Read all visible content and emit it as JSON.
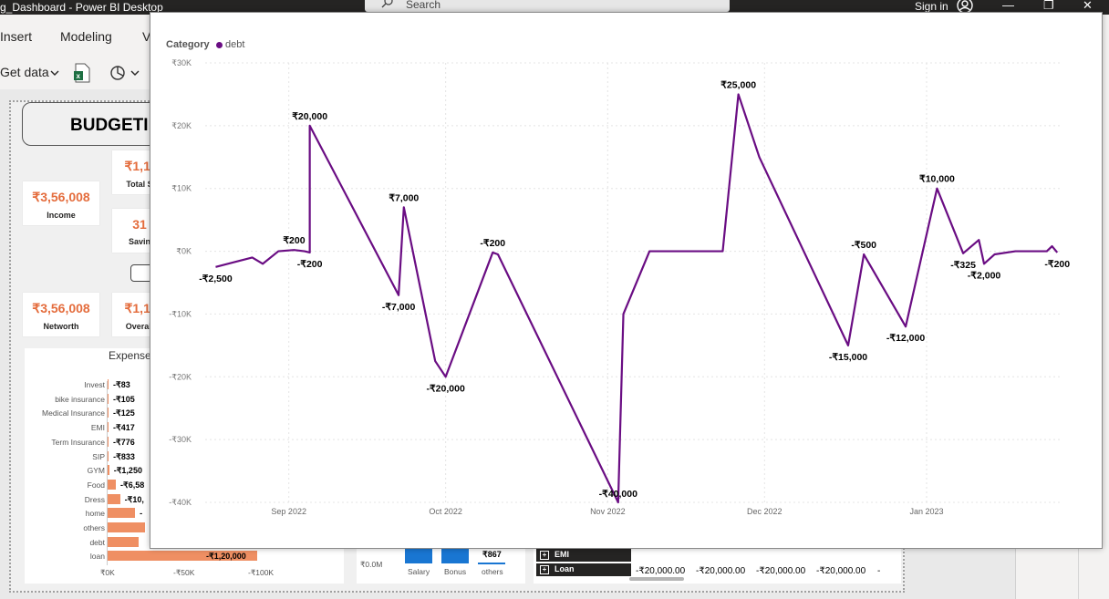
{
  "window": {
    "title": "g_Dashboard - Power BI Desktop",
    "search_text": "Search",
    "signin": "Sign in",
    "minimize": "—",
    "restore": "❐",
    "close": "✕"
  },
  "ribbon": {
    "tabs": [
      "Insert",
      "Modeling",
      "V"
    ],
    "get_data": "Get data"
  },
  "report": {
    "title": "BUDGETI",
    "cards": [
      {
        "value": "₹1,1:",
        "label": "Total S"
      },
      {
        "value": "₹3,56,008",
        "label": "Income"
      },
      {
        "value": "31",
        "label": "Savin"
      },
      {
        "value": "₹3,56,008",
        "label": "Networth"
      },
      {
        "value": "₹1,1:",
        "label": "Overall"
      }
    ],
    "expense": {
      "title": "Expense",
      "rows": [
        {
          "cat": "Invest",
          "value": -83,
          "label": "-₹83"
        },
        {
          "cat": "bike insurance",
          "value": -105,
          "label": "-₹105"
        },
        {
          "cat": "Medical Insurance",
          "value": -125,
          "label": "-₹125"
        },
        {
          "cat": "EMI",
          "value": -417,
          "label": "-₹417"
        },
        {
          "cat": "Term Insurance",
          "value": -776,
          "label": "-₹776"
        },
        {
          "cat": "SIP",
          "value": -833,
          "label": "-₹833"
        },
        {
          "cat": "GYM",
          "value": -1250,
          "label": "-₹1,250"
        },
        {
          "cat": "Food",
          "value": -6580,
          "label": "-₹6,58"
        },
        {
          "cat": "Dress",
          "value": -10000,
          "label": "-₹10,"
        },
        {
          "cat": "home",
          "value": -22000,
          "label": "-"
        },
        {
          "cat": "others",
          "value": -30000,
          "label": ""
        },
        {
          "cat": "debt",
          "value": -25000,
          "label": ""
        },
        {
          "cat": "loan",
          "value": -120000,
          "label": "-₹1,20,000"
        }
      ],
      "xticks": [
        "₹0K",
        "-₹50K",
        "-₹100K"
      ]
    },
    "income_mini": {
      "axis": "₹0.0M",
      "labels": [
        "Salary",
        "Bonus",
        "others"
      ],
      "others_value": "₹867"
    },
    "matrix": {
      "rows": [
        "EMI",
        "Loan"
      ],
      "cells": [
        "-₹20,000.00",
        "-₹20,000.00",
        "-₹20,000.00",
        "-₹20,000.00",
        "-"
      ]
    }
  },
  "chart_data": {
    "type": "line",
    "legend_title": "Category",
    "series": [
      {
        "name": "debt",
        "color": "#6a0d83"
      }
    ],
    "ylim": [
      -40000,
      30000
    ],
    "yticks": [
      "₹30K",
      "₹20K",
      "₹10K",
      "₹0K",
      "-₹10K",
      "-₹20K",
      "-₹30K",
      "-₹40K"
    ],
    "xticks": [
      "Sep 2022",
      "Oct 2022",
      "Nov 2022",
      "Dec 2022",
      "Jan 2023"
    ],
    "x": [
      "2022-08-18",
      "2022-08-25",
      "2022-08-27",
      "2022-08-30",
      "2022-09-02",
      "2022-09-04",
      "2022-09-05",
      "2022-09-05",
      "2022-09-22",
      "2022-09-23",
      "2022-09-29",
      "2022-10-01",
      "2022-10-10",
      "2022-10-11",
      "2022-11-03",
      "2022-11-04",
      "2022-11-09",
      "2022-11-23",
      "2022-11-26",
      "2022-11-30",
      "2022-12-17",
      "2022-12-20",
      "2022-12-28",
      "2023-01-03",
      "2023-01-08",
      "2023-01-11",
      "2023-01-12",
      "2023-01-14",
      "2023-01-18",
      "2023-01-24",
      "2023-01-25",
      "2023-01-26"
    ],
    "values": [
      -2500,
      -1000,
      -2000,
      0,
      200,
      0,
      -200,
      20000,
      -7000,
      7000,
      -17500,
      -20000,
      -200,
      -500,
      -40000,
      -10000,
      0,
      0,
      25000,
      15000,
      -15000,
      -500,
      -12000,
      10000,
      -325,
      1800,
      -2000,
      -500,
      0,
      0,
      800,
      -200
    ],
    "point_labels": [
      {
        "i": 0,
        "text": "-₹2,500"
      },
      {
        "i": 4,
        "text": "₹200"
      },
      {
        "i": 6,
        "text": "-₹200"
      },
      {
        "i": 7,
        "text": "₹20,000"
      },
      {
        "i": 8,
        "text": "-₹7,000"
      },
      {
        "i": 9,
        "text": "₹7,000"
      },
      {
        "i": 11,
        "text": "-₹20,000"
      },
      {
        "i": 12,
        "text": "-₹200"
      },
      {
        "i": 14,
        "text": "-₹40,000"
      },
      {
        "i": 18,
        "text": "₹25,000"
      },
      {
        "i": 20,
        "text": "-₹15,000"
      },
      {
        "i": 21,
        "text": "-₹500"
      },
      {
        "i": 22,
        "text": "-₹12,000"
      },
      {
        "i": 23,
        "text": "₹10,000"
      },
      {
        "i": 24,
        "text": "-₹325"
      },
      {
        "i": 26,
        "text": "-₹2,000"
      },
      {
        "i": 31,
        "text": "-₹200"
      }
    ],
    "grid": true
  }
}
